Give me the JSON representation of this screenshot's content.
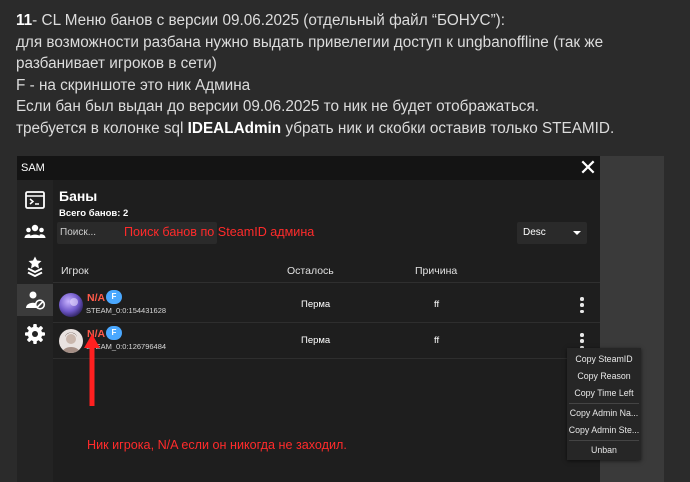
{
  "post": {
    "number": "11",
    "line1_rest": "- CL Меню банов с версии 09.06.2025 (отдельный файл “БОНУС”):",
    "line2": "для возможности разбана нужно выдать привелегии доступ к ungbanoffline (так же разбанивает игроков в сети)",
    "line3": "F - на скриншоте это ник Админа",
    "line4": "Если бан был выдан до версии 09.06.2025 то ник не будет отображаться.",
    "line5_before": "требуется в колонке sql ",
    "line5_bold": "IDEALAdmin",
    "line5_after": " убрать ник и скобки оставив только STEAMID."
  },
  "window": {
    "title": "SAM",
    "close_glyph": "✕"
  },
  "sidebar": {
    "items": [
      {
        "icon": "terminal-icon"
      },
      {
        "icon": "users-icon"
      },
      {
        "icon": "rank-badge-icon"
      },
      {
        "icon": "user-ban-icon",
        "active": true
      },
      {
        "icon": "gear-icon"
      }
    ]
  },
  "bans": {
    "title": "Баны",
    "total": "Всего банов: 2",
    "search_placeholder": "Поиск...",
    "sort_value": "Desc",
    "columns": {
      "player": "Игрок",
      "remaining": "Осталось",
      "reason": "Причина"
    },
    "rows": [
      {
        "nick": "N/A",
        "badge": "F",
        "steamid": "STEAM_0:0:154431628",
        "remaining": "Перма",
        "reason": "ff"
      },
      {
        "nick": "N/A",
        "badge": "F",
        "steamid": "STEAM_0:0:126796484",
        "remaining": "Перма",
        "reason": "ff"
      }
    ]
  },
  "context_menu": {
    "items": [
      "Copy SteamID",
      "Copy Reason",
      "Copy Time Left",
      "Copy Admin Na...",
      "Copy Admin Ste...",
      "Unban"
    ]
  },
  "annotations": {
    "search": "Поиск банов по SteamID админа",
    "nick": "Ник игрока, N/A если он никогда не заходил."
  },
  "colors": {
    "annotation_red": "#ff2b2b",
    "nick_red": "#ff5a4a",
    "badge_blue": "#4aa8ff"
  }
}
